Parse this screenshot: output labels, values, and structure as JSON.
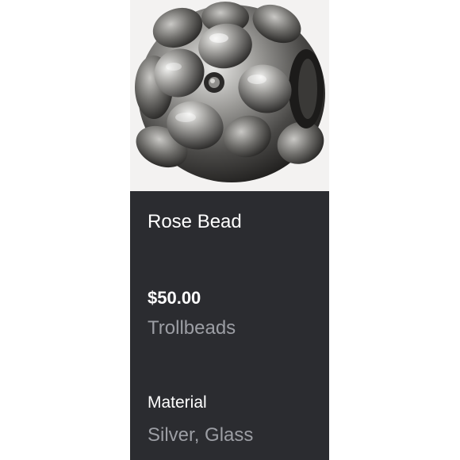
{
  "product": {
    "image_alt": "bead-photo",
    "name": "Rose Bead",
    "price": "$50.00",
    "brand": "Trollbeads",
    "specs": [
      {
        "label": "Material",
        "value": "Silver, Glass"
      }
    ]
  },
  "colors": {
    "card_background": "#2b2c30",
    "image_background": "#f3f2f1",
    "primary_text": "#ffffff",
    "secondary_text": "#9c9ea4"
  }
}
